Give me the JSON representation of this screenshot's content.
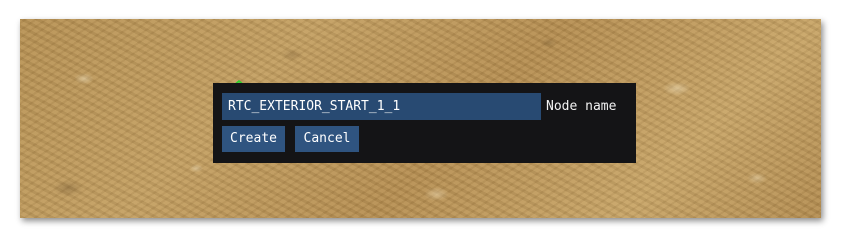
{
  "viewport": {
    "background": "terrain-sand-texture"
  },
  "node_marker": {
    "icon": "house-outline-icon",
    "color": "#2bd12b"
  },
  "dialog": {
    "name_input": {
      "value": "RTC_EXTERIOR_START_1_1"
    },
    "field_label": "Node name",
    "buttons": {
      "create_label": "Create",
      "cancel_label": "Cancel"
    }
  },
  "colors": {
    "dialog_background": "#141416",
    "input_background": "#284a72",
    "button_background": "#2f5480",
    "text": "#ffffff"
  }
}
